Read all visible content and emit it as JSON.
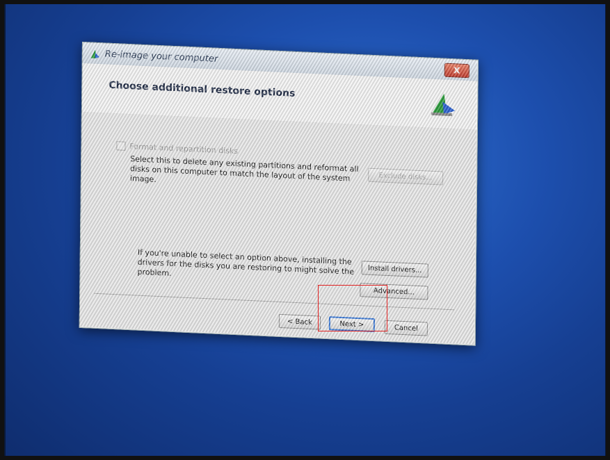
{
  "window": {
    "title": "Re-image your computer",
    "close_label": "X"
  },
  "header": {
    "heading": "Choose additional restore options"
  },
  "options": {
    "format_label": "Format and repartition disks",
    "format_description": "Select this to delete any existing partitions and reformat all disks on this computer to match the layout of the system image.",
    "exclude_disks_label": "Exclude disks...",
    "hint_text": "If you're unable to select an option above, installing the drivers for the disks you are restoring to might solve the problem.",
    "install_drivers_label": "Install drivers...",
    "advanced_label": "Advanced..."
  },
  "footer": {
    "back_label": "< Back",
    "next_label": "Next >",
    "cancel_label": "Cancel"
  },
  "colors": {
    "highlight": "#e02020",
    "desktop_blue": "#1d4fae"
  }
}
